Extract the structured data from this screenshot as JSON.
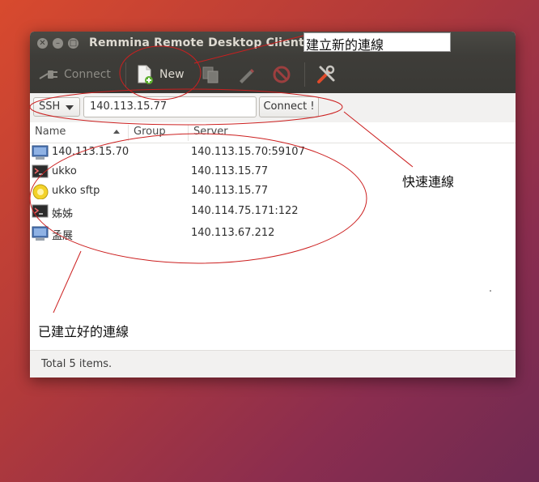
{
  "window": {
    "title": "Remmina Remote Desktop Client"
  },
  "toolbar": {
    "connect_label": "Connect",
    "new_label": "New"
  },
  "quickbar": {
    "protocol": "SSH",
    "address": "140.113.15.77",
    "connect_button": "Connect !"
  },
  "columns": {
    "name": "Name",
    "group": "Group",
    "server": "Server"
  },
  "connections": [
    {
      "name": "140.113.15.70",
      "group": "",
      "server": "140.113.15.70:59107",
      "icon": "remote-desktop-icon"
    },
    {
      "name": "ukko",
      "group": "",
      "server": "140.113.15.77",
      "icon": "terminal-icon"
    },
    {
      "name": "ukko sftp",
      "group": "",
      "server": "140.113.15.77",
      "icon": "sftp-icon"
    },
    {
      "name": "姊姊",
      "group": "",
      "server": "140.114.75.171:122",
      "icon": "terminal-icon"
    },
    {
      "name": "孟展",
      "group": "",
      "server": "140.113.67.212",
      "icon": "remote-desktop-icon"
    }
  ],
  "status": {
    "text": "Total 5 items."
  },
  "annotations": {
    "new_connection": "建立新的連線",
    "quick_connect": "快速連線",
    "saved_connections": "已建立好的連線"
  },
  "colors": {
    "annotation_red": "#cc1f1f",
    "titlebar": "#3e3d39"
  }
}
